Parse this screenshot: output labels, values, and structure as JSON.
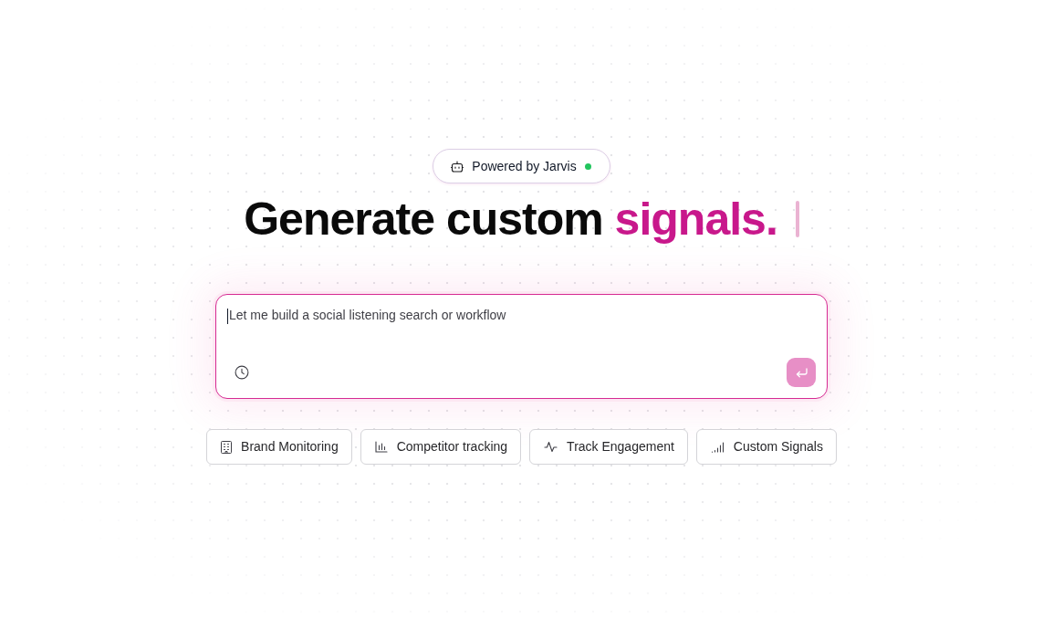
{
  "badge": {
    "label": "Powered by Jarvis",
    "online": true
  },
  "headline": {
    "text": "Generate custom",
    "highlight": "signals."
  },
  "prompt": {
    "placeholder": "Let me build a social listening search or workflow",
    "focused": true
  },
  "send_button": {
    "disabled": true
  },
  "suggestions": [
    {
      "label": "Brand Monitoring"
    },
    {
      "label": "Competitor tracking"
    },
    {
      "label": "Track Engagement"
    },
    {
      "label": "Custom Signals"
    }
  ]
}
